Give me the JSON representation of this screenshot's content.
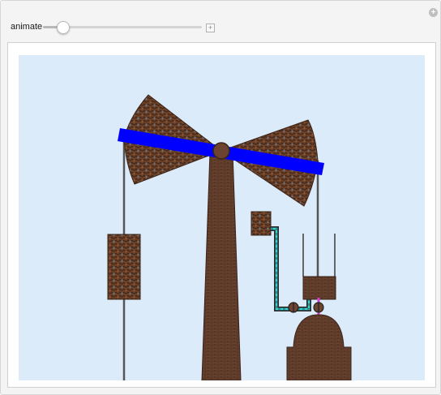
{
  "control": {
    "label": "animate",
    "value_fraction": 0.12
  },
  "icons": {
    "corner": "plus-circle-icon",
    "slider_expand": "plus-square-icon"
  },
  "colors": {
    "sky": "#dcebfa",
    "beam": "#0000ff",
    "brick": "#6b4330",
    "rope": "#555555",
    "cyan_pipe": "#30d6d6",
    "magenta_rod": "#d43cd4"
  }
}
